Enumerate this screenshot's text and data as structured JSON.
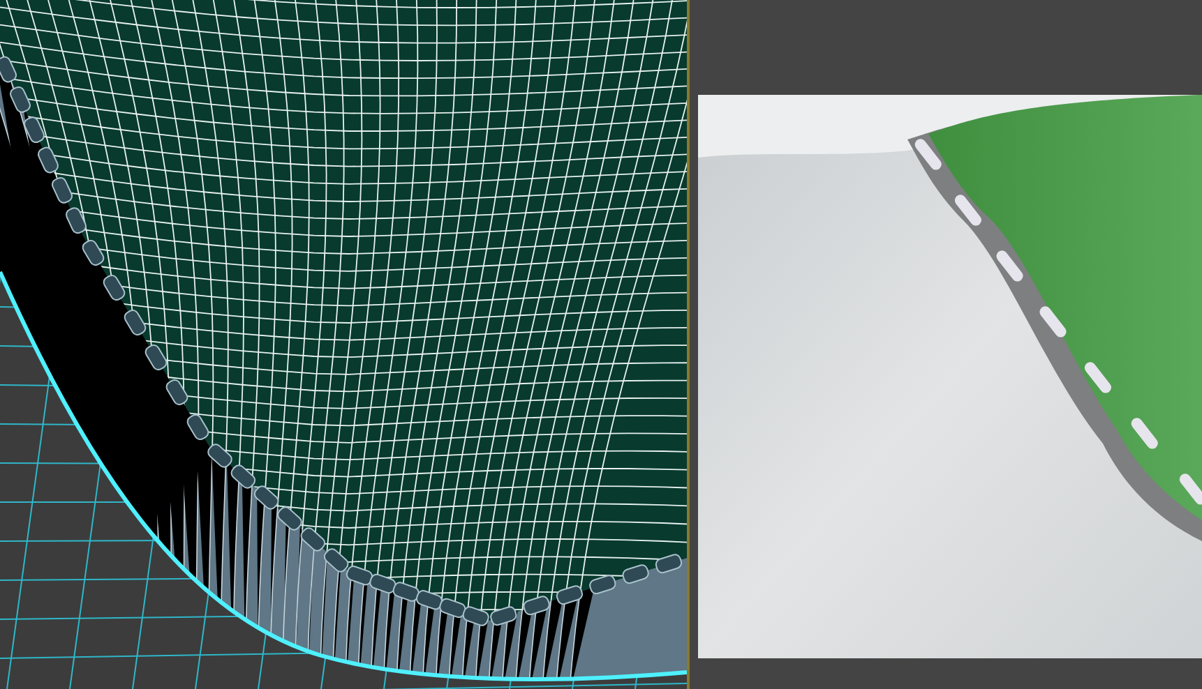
{
  "viewports": [
    {
      "kind": "wireframe"
    },
    {
      "kind": "render"
    }
  ]
}
